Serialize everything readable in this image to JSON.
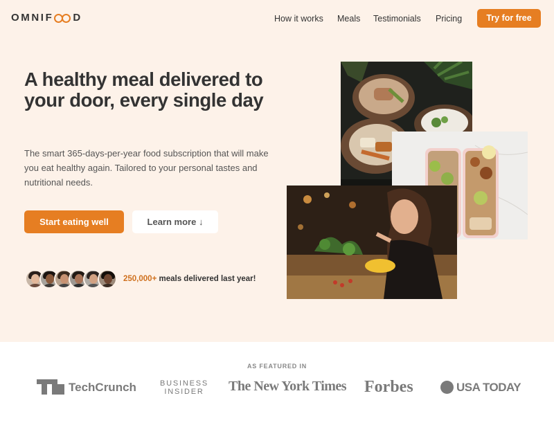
{
  "brand": {
    "name_prefix": "OMNIF",
    "name_suffix": "D",
    "accent": "#e67e22"
  },
  "nav": {
    "links": [
      "How it works",
      "Meals",
      "Testimonials",
      "Pricing"
    ],
    "cta": "Try for free"
  },
  "hero": {
    "title": "A healthy meal delivered to your door, every single day",
    "description": "The smart 365-days-per-year food subscription that will make you eat healthy again. Tailored to your personal tastes and nutritional needs.",
    "primary_button": "Start eating well",
    "secondary_button": "Learn more ↓",
    "delivered_count": "250,000+",
    "delivered_text": " meals delivered last year!",
    "background": "#fdf2e9"
  },
  "featured": {
    "label": "AS FEATURED IN",
    "logos": [
      "TechCrunch",
      "BUSINESS",
      "INSIDER",
      "The New York Times",
      "Forbes",
      "USA TODAY"
    ]
  }
}
